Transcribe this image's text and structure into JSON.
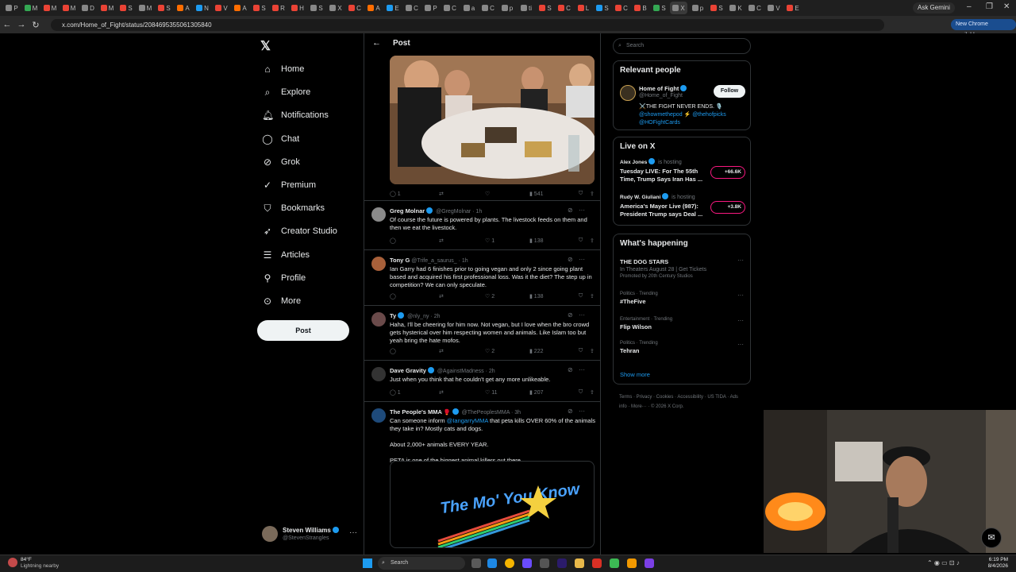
{
  "browser": {
    "url": "x.com/Home_of_Fight/status/2084695355061305840",
    "ask_gemini": "Ask Gemini",
    "new_chrome": "New Chrome available",
    "tabs": [
      {
        "label": "P",
        "color": "#888888"
      },
      {
        "label": "M",
        "color": "#34a853"
      },
      {
        "label": "M",
        "color": "#ea4335"
      },
      {
        "label": "M",
        "color": "#ea4335"
      },
      {
        "label": "D",
        "color": "#888888"
      },
      {
        "label": "M",
        "color": "#ea4335"
      },
      {
        "label": "S",
        "color": "#ea4335"
      },
      {
        "label": "M",
        "color": "#888888"
      },
      {
        "label": "S",
        "color": "#ea4335"
      },
      {
        "label": "A",
        "color": "#ff6d00"
      },
      {
        "label": "N",
        "color": "#1d9bf0"
      },
      {
        "label": "V",
        "color": "#ea4335"
      },
      {
        "label": "A",
        "color": "#ff6d00"
      },
      {
        "label": "S",
        "color": "#ea4335"
      },
      {
        "label": "R",
        "color": "#ea4335"
      },
      {
        "label": "H",
        "color": "#ea4335"
      },
      {
        "label": "S",
        "color": "#888888"
      },
      {
        "label": "X",
        "color": "#888888"
      },
      {
        "label": "C",
        "color": "#ea4335"
      },
      {
        "label": "A",
        "color": "#ff6d00"
      },
      {
        "label": "E",
        "color": "#1d9bf0"
      },
      {
        "label": "C",
        "color": "#888888"
      },
      {
        "label": "P",
        "color": "#888888"
      },
      {
        "label": "C",
        "color": "#888888"
      },
      {
        "label": "a",
        "color": "#888888"
      },
      {
        "label": "C",
        "color": "#888888"
      },
      {
        "label": "p",
        "color": "#888888"
      },
      {
        "label": "ti",
        "color": "#888888"
      },
      {
        "label": "S",
        "color": "#ea4335"
      },
      {
        "label": "C",
        "color": "#ea4335"
      },
      {
        "label": "L",
        "color": "#ea4335"
      },
      {
        "label": "S",
        "color": "#1d9bf0"
      },
      {
        "label": "C",
        "color": "#ea4335"
      },
      {
        "label": "B",
        "color": "#ea4335"
      },
      {
        "label": "S",
        "color": "#34a853"
      },
      {
        "label": "X",
        "color": "#888888"
      },
      {
        "label": "p",
        "color": "#888888"
      },
      {
        "label": "S",
        "color": "#ea4335"
      },
      {
        "label": "K",
        "color": "#888888"
      },
      {
        "label": "C",
        "color": "#888888"
      },
      {
        "label": "V",
        "color": "#888888"
      },
      {
        "label": "E",
        "color": "#ea4335"
      }
    ]
  },
  "nav": {
    "items": [
      {
        "label": "Home",
        "icon": "⌂",
        "name": "home"
      },
      {
        "label": "Explore",
        "icon": "⌕",
        "name": "explore"
      },
      {
        "label": "Notifications",
        "icon": "🔔︎",
        "name": "notifications"
      },
      {
        "label": "Chat",
        "icon": "◯",
        "name": "chat"
      },
      {
        "label": "Grok",
        "icon": "⊘",
        "name": "grok"
      },
      {
        "label": "Premium",
        "icon": "✓",
        "name": "premium"
      },
      {
        "label": "Bookmarks",
        "icon": "⛉",
        "name": "bookmarks"
      },
      {
        "label": "Creator Studio",
        "icon": "➶",
        "name": "creator-studio"
      },
      {
        "label": "Articles",
        "icon": "☰",
        "name": "articles"
      },
      {
        "label": "Profile",
        "icon": "⚲",
        "name": "profile"
      },
      {
        "label": "More",
        "icon": "⊙",
        "name": "more"
      }
    ],
    "post_button": "Post",
    "account": {
      "name": "Steven Williams",
      "handle": "@StevenStrangles"
    }
  },
  "header": {
    "title": "Post"
  },
  "photo_actions": {
    "replies": "1",
    "views": "541"
  },
  "tweets": [
    {
      "name": "Greg Molnar",
      "verified": true,
      "handle": "@GregMolnar · 1h",
      "text": "Of course the future is powered by plants. The livestock feeds on them and then we eat the livestock.",
      "replies": "",
      "likes": "1",
      "views": "138",
      "avatar_color": "#8a8a8a"
    },
    {
      "name": "Tony G",
      "verified": false,
      "handle": "@Trife_a_saurus_ · 1h",
      "text": "Ian Garry had 6 finishes prior to going vegan and only 2 since going plant based and acquired his first professional loss. Was it the diet? The step up in competition? We can only speculate.",
      "replies": "",
      "likes": "2",
      "views": "138",
      "avatar_color": "#a8603a"
    },
    {
      "name": "Ty",
      "verified": true,
      "handle": "@nly_ny · 2h",
      "text": "Haha, I'll be cheering for him now. Not vegan, but I love when the bro crowd gets hysterical over him respecting women and animals. Like Islam too but yeah bring the hate mofos.",
      "replies": "",
      "likes": "2",
      "views": "222",
      "avatar_color": "#6a4a4a"
    },
    {
      "name": "Dave Gravity",
      "verified": true,
      "handle": "@AgainstMadness · 2h",
      "text": "Just when you think that he couldn't get any more unlikeable.",
      "replies": "1",
      "likes": "11",
      "views": "207",
      "avatar_color": "#333333"
    }
  ],
  "mma_tweet": {
    "name": "The People's MMA",
    "badge": "🥊",
    "handle": "@ThePeoplesMMA · 3h",
    "text_before": "Can someone inform ",
    "mention": "@IangarryMMA",
    "text_after": " that peta kills OVER 60% of the animals they take in? Mostly cats and dogs.",
    "line2": "About 2,000+ animals EVERY YEAR.",
    "line3": "PETA is one of the biggest animal killers out there.",
    "gif_text": "The Mo' You Know"
  },
  "right": {
    "search_placeholder": "Search",
    "relevant": {
      "title": "Relevant people",
      "name": "Home of Fight",
      "handle": "@Home_of_Fight",
      "follow": "Follow",
      "bio1": "⚔️THE FIGHT NEVER ENDS. 🎙️",
      "bio_link1": "@showmethepod",
      "bio_sep": " ⚡ ",
      "bio_link2": "@thehofpicks",
      "bio_link3": "@HOFightCards"
    },
    "live": {
      "title": "Live on X",
      "items": [
        {
          "host": "Alex Jones",
          "status": "is hosting",
          "title": "Tuesday LIVE: For The 55th Time, Trump Says Iran Has ...",
          "count": "+66.6K"
        },
        {
          "host": "Rudy W. Giuliani",
          "status": "is hosting",
          "title": "America's Mayor Live (987): President Trump says Deal ...",
          "count": "+3.8K"
        }
      ]
    },
    "happening": {
      "title": "What's happening",
      "items": [
        {
          "category": "",
          "topic": "THE DOG STARS",
          "sub": "In Theaters August 28 | Get Tickets",
          "promo": "Promoted by 20th Century Studios"
        },
        {
          "category": "Politics · Trending",
          "topic": "#TheFive",
          "sub": "",
          "promo": ""
        },
        {
          "category": "Entertainment · Trending",
          "topic": "Flip Wilson",
          "sub": "",
          "promo": ""
        },
        {
          "category": "Politics · Trending",
          "topic": "Tehran",
          "sub": "",
          "promo": ""
        }
      ],
      "show_more": "Show more"
    },
    "footer": "Terms · Privacy · Cookies · Accessibility · US TIDA · Ads info · More··· · © 2026 X Corp."
  },
  "taskbar": {
    "weather_temp": "84°F",
    "weather_text": "Lightning nearby",
    "search": "Search",
    "time": "6:19 PM",
    "date": "8/4/2026"
  }
}
